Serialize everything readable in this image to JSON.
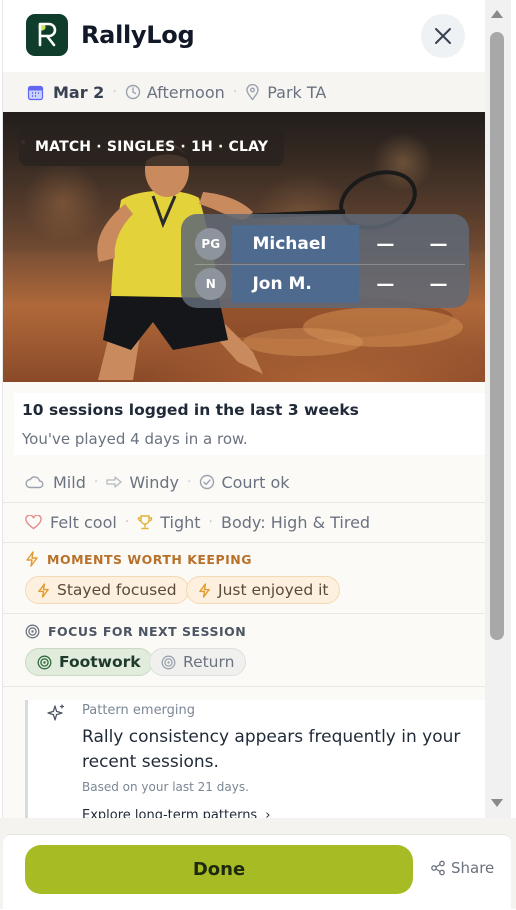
{
  "app": {
    "title": "RallyLog"
  },
  "meta": {
    "date": "Mar 2",
    "time": "Afternoon",
    "location": "Park TA"
  },
  "hero": {
    "tag": "MATCH · SINGLES · 1H · CLAY",
    "players": [
      {
        "badge": "PG",
        "name": "Michael",
        "scores": [
          "—",
          "—"
        ]
      },
      {
        "badge": "N",
        "name": "Jon M.",
        "scores": [
          "—",
          "—"
        ]
      }
    ]
  },
  "stats": {
    "headline": "10 sessions logged in the last 3 weeks",
    "subline": "You've played 4 days in a row."
  },
  "conditions": {
    "weather": "Mild",
    "wind": "Windy",
    "court": "Court ok"
  },
  "feelings": {
    "feel": "Felt cool",
    "state": "Tight",
    "body": "Body: High & Tired"
  },
  "moments": {
    "label": "MOMENTS WORTH KEEPING",
    "chips": [
      "Stayed focused",
      "Just enjoyed it"
    ]
  },
  "focus": {
    "label": "FOCUS FOR NEXT SESSION",
    "chips": [
      "Footwork",
      "Return"
    ]
  },
  "pattern": {
    "label": "Pattern emerging",
    "text": "Rally consistency appears frequently in your recent sessions.",
    "note": "Based on your last 21 days.",
    "link": "Explore long-term patterns"
  },
  "footer": {
    "done": "Done",
    "share": "Share"
  },
  "colors": {
    "accent": "#a7bb25",
    "brand": "#0f3d2c",
    "moment": "#e39a2e",
    "focus": "#2f6b3d"
  }
}
